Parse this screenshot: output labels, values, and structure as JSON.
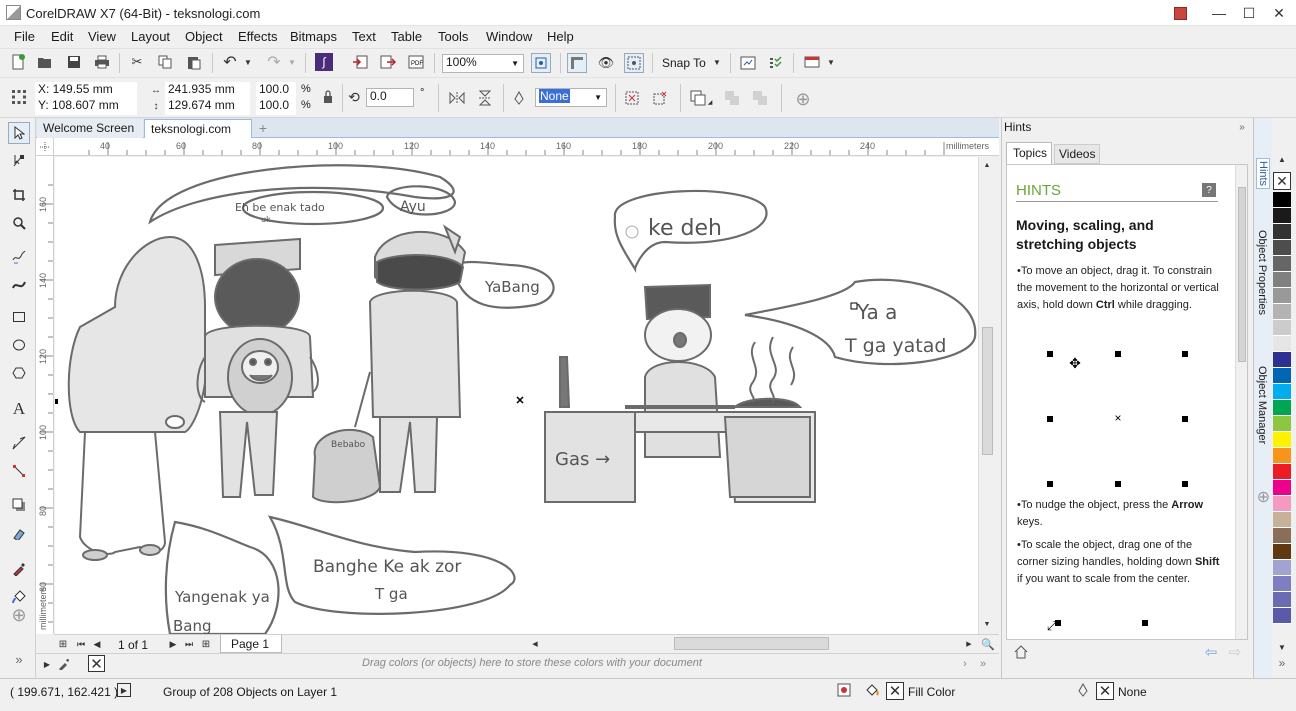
{
  "window": {
    "title": "CorelDRAW X7 (64-Bit) - teksnologi.com"
  },
  "menu": [
    "File",
    "Edit",
    "View",
    "Layout",
    "Object",
    "Effects",
    "Bitmaps",
    "Text",
    "Table",
    "Tools",
    "Window",
    "Help"
  ],
  "toolbar": {
    "zoom": "100%",
    "snap_to": "Snap To"
  },
  "property_bar": {
    "x": "X: 149.55 mm",
    "y": "Y: 108.607 mm",
    "width": "241.935 mm",
    "height": "129.674 mm",
    "scale_w": "100.0",
    "scale_h": "100.0",
    "scale_unit": "%",
    "rotation": "0.0",
    "rotation_unit": "°",
    "outline": "None"
  },
  "doc_tabs": [
    "Welcome Screen",
    "teksnologi.com"
  ],
  "rulers": {
    "top_ticks": [
      "40",
      "60",
      "80",
      "100",
      "120",
      "140",
      "160",
      "180",
      "200",
      "220",
      "240"
    ],
    "top_unit": "millimeters",
    "left_ticks": [
      "160",
      "140",
      "120",
      "100",
      "80",
      "60"
    ],
    "left_unit": "millimeters"
  },
  "drawing": {
    "bubble_1": "Eh  be  enak tado",
    "bubble_1_sub": "uk",
    "bubble_ayu": "Ayu",
    "bubble_oke": "ke  deh",
    "bubble_yabang": "YaBang",
    "bubble_ya": "Ya    a",
    "bubble_ya2": "T ga  yatad",
    "bubble_bang": "Banghe    Ke ak zor",
    "bubble_bang2": "T ga",
    "bubble_yang": "Yangenak ya",
    "bubble_yang2": "Bang",
    "sign_gas": "Gas →",
    "bag_text": "Bebabo"
  },
  "page_nav": {
    "count": "1 of 1",
    "page_tab": "Page 1"
  },
  "doc_palette_hint": "Drag colors (or objects) here to store these colors with your document",
  "hints": {
    "panel_title": "Hints",
    "tabs": [
      "Topics",
      "Videos"
    ],
    "heading": "HINTS",
    "title": "Moving, scaling, and stretching objects",
    "p1_a": "To move an object, drag it. To constrain the movement to the horizontal or vertical axis, hold down ",
    "p1_key": "Ctrl",
    "p1_b": " while dragging.",
    "p2_a": "To nudge the object, press the ",
    "p2_key": "Arrow",
    "p2_b": " keys.",
    "p3_a": "To scale the object, drag one of the corner sizing handles, holding down ",
    "p3_key": "Shift",
    "p3_b": " if you want to scale from the center."
  },
  "docker_tabs": [
    "Hints",
    "Object Properties",
    "Object Manager"
  ],
  "palette_colors": [
    "#ffffff",
    "#000000",
    "#1a1a1a",
    "#333333",
    "#4d4d4d",
    "#666666",
    "#808080",
    "#999999",
    "#b3b3b3",
    "#cccccc",
    "#e6e6e6",
    "#2e3192",
    "#0066b3",
    "#00aeef",
    "#00a651",
    "#8dc63f",
    "#fff200",
    "#f7941d",
    "#ed1c24",
    "#ec008c",
    "#f49ac1",
    "#c7b299",
    "#8b6e5a",
    "#603913",
    "#a3a3d1",
    "#7f7fbf",
    "#6b6bb3",
    "#5a5aa8"
  ],
  "status": {
    "coords": "( 199.671, 162.421 )",
    "info": "Group of 208 Objects on Layer 1",
    "fill_label": "Fill Color",
    "outline_label": "None"
  }
}
